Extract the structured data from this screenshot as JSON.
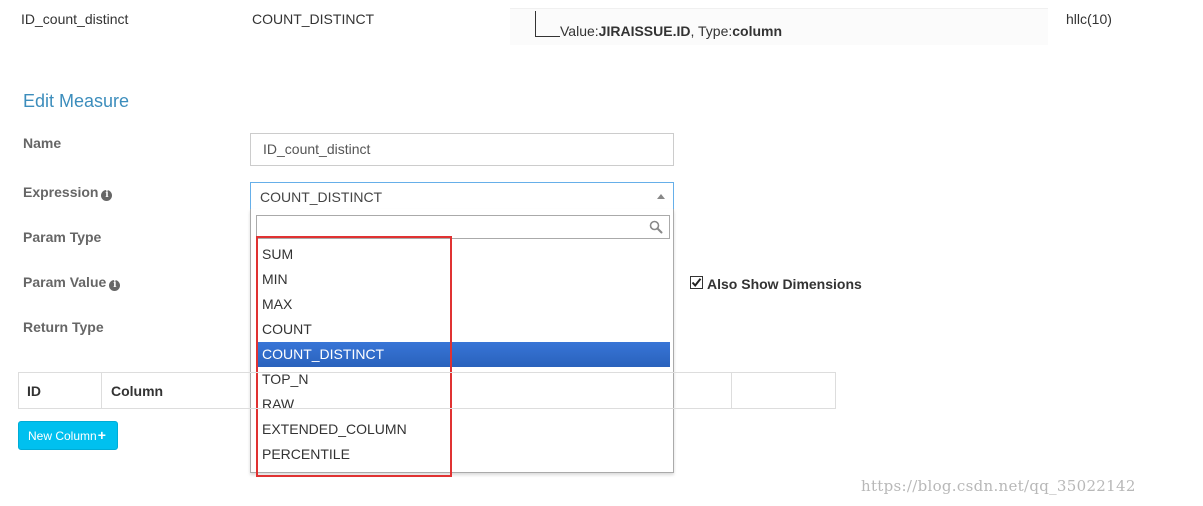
{
  "top_row": {
    "name": "ID_count_distinct",
    "expression": "COUNT_DISTINCT",
    "param_value_prefix": "Value:",
    "param_value": "JIRAISSUE.ID",
    "param_type_prefix": ", Type:",
    "param_type": "column",
    "return_type": "hllc(10)"
  },
  "edit_measure": {
    "title": "Edit Measure",
    "labels": {
      "name": "Name",
      "expression": "Expression",
      "param_type": "Param Type",
      "param_value": "Param Value",
      "return_type": "Return Type"
    },
    "name_value": "ID_count_distinct",
    "expression_value": "COUNT_DISTINCT",
    "search_placeholder": "",
    "options": [
      "SUM",
      "MIN",
      "MAX",
      "COUNT",
      "COUNT_DISTINCT",
      "TOP_N",
      "RAW",
      "EXTENDED_COLUMN",
      "PERCENTILE"
    ],
    "selected_option": "COUNT_DISTINCT",
    "also_show_dimensions": {
      "label": "Also Show Dimensions",
      "checked": true
    }
  },
  "table": {
    "headers": [
      "ID",
      "Column"
    ]
  },
  "new_column_button": "New Column",
  "watermark": "https://blog.csdn.net/qq_35022142",
  "colors": {
    "accent_title": "#3c8dbc",
    "selected_option": "#2a62bc",
    "button": "#00c0ef",
    "highlight_box": "#e03232"
  }
}
